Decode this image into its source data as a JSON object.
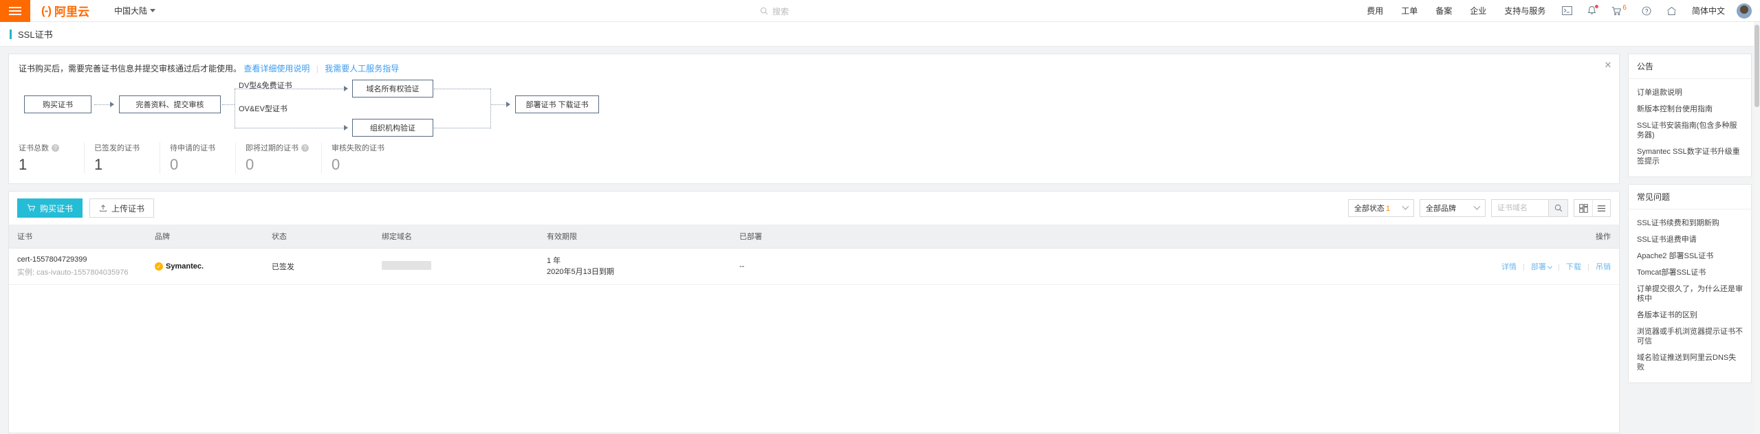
{
  "header": {
    "logo_text": "阿里云",
    "region": "中国大陆",
    "search_placeholder": "搜索",
    "nav": [
      "费用",
      "工单",
      "备案",
      "企业",
      "支持与服务"
    ],
    "icons": [
      "console-icon",
      "bell-icon",
      "cart-icon",
      "help-icon",
      "home-icon"
    ],
    "cart_count": "6",
    "language": "简体中文"
  },
  "page": {
    "title": "SSL证书"
  },
  "notice": {
    "text": "证书购买后，需要完善证书信息并提交审核通过后才能使用。",
    "link1": "查看详细使用说明",
    "link2": "我需要人工服务指导",
    "close": "✕"
  },
  "flow": {
    "box_buy": "购买证书",
    "box_submit": "完善资料、提交审核",
    "label_dv": "DV型&免费证书",
    "label_ov": "OV&EV型证书",
    "box_domain": "域名所有权验证",
    "box_org": "组织机构验证",
    "box_deploy": "部署证书  下载证书"
  },
  "stats": [
    {
      "label": "证书总数",
      "value": "1",
      "help": true
    },
    {
      "label": "已签发的证书",
      "value": "1",
      "help": false
    },
    {
      "label": "待申请的证书",
      "value": "0",
      "help": false
    },
    {
      "label": "即将过期的证书",
      "value": "0",
      "help": true
    },
    {
      "label": "审核失败的证书",
      "value": "0",
      "help": false
    }
  ],
  "toolbar": {
    "buy_label": "购买证书",
    "upload_label": "上传证书",
    "status_filter": "全部状态",
    "status_count": "1",
    "brand_filter": "全部品牌",
    "search_placeholder": "证书域名",
    "search_value": ""
  },
  "table": {
    "columns": [
      "证书",
      "品牌",
      "状态",
      "绑定域名",
      "有效期限",
      "已部署",
      "",
      "操作"
    ],
    "rows": [
      {
        "cert_name": "cert-1557804729399",
        "cert_instance": "实例: cas-ivauto-1557804035976",
        "brand": "Symantec.",
        "status": "已签发",
        "domain": "",
        "validity_years": "1 年",
        "validity_expire": "2020年5月13日到期",
        "deployed": "--",
        "actions": [
          "详情",
          "部署",
          "下载",
          "吊销"
        ]
      }
    ]
  },
  "sidebar": {
    "announcements": {
      "title": "公告",
      "items": [
        "订单退款说明",
        "新版本控制台使用指南",
        "SSL证书安装指南(包含多种服务器)",
        "Symantec SSL数字证书升级重签提示"
      ]
    },
    "faq": {
      "title": "常见问题",
      "items": [
        "SSL证书续费和到期新购",
        "SSL证书退费申请",
        "Apache2 部署SSL证书",
        "Tomcat部署SSL证书",
        "订单提交很久了，为什么还是审核中",
        "各版本证书的区别",
        "浏览器或手机浏览器提示证书不可信",
        "域名验证推送到阿里云DNS失败"
      ]
    }
  },
  "colors": {
    "brand_orange": "#ff6a00",
    "accent_cyan": "#25bcd6",
    "link_blue": "#3b9cf0"
  }
}
